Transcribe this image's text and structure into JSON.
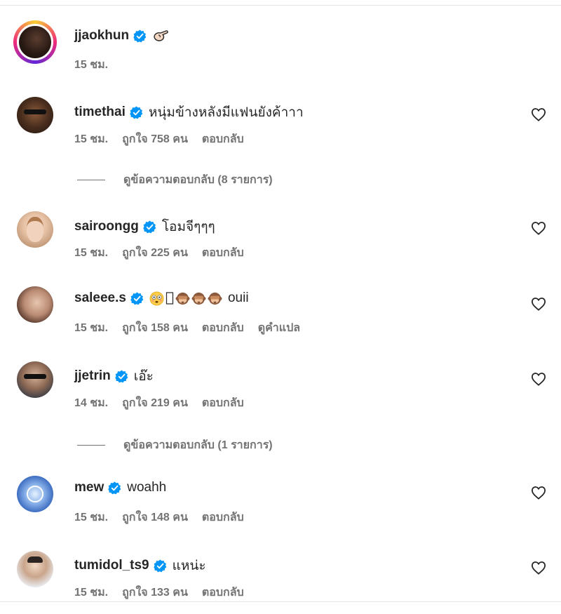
{
  "comments": [
    {
      "username": "jjaokhun",
      "text": "",
      "time": "15 ชม.",
      "likes": "",
      "reply": "",
      "translate": "",
      "has_heart": false,
      "emoji": "pinching-hand"
    },
    {
      "username": "timethai",
      "text": "หนุ่มข้างหลังมีแฟนยังค้าาา",
      "time": "15 ชม.",
      "likes": "ถูกใจ 758 คน",
      "reply": "ตอบกลับ",
      "translate": "",
      "has_heart": true
    },
    {
      "username": "sairoongg",
      "text": "โอมจีๆๆๆ",
      "time": "15 ชม.",
      "likes": "ถูกใจ 225 คน",
      "reply": "ตอบกลับ",
      "translate": "",
      "has_heart": true
    },
    {
      "username": "saleee.s",
      "text": "ouii",
      "time": "15 ชม.",
      "likes": "ถูกใจ 158 คน",
      "reply": "ตอบกลับ",
      "translate": "ดูคำแปล",
      "has_heart": true,
      "emoji": "flushed-face, box, see-no-evil-monkey x3"
    },
    {
      "username": "jjetrin",
      "text": "เอ๊ะ",
      "time": "14 ชม.",
      "likes": "ถูกใจ 219 คน",
      "reply": "ตอบกลับ",
      "translate": "",
      "has_heart": true
    },
    {
      "username": "mew",
      "text": "woahh",
      "time": "15 ชม.",
      "likes": "ถูกใจ 148 คน",
      "reply": "ตอบกลับ",
      "translate": "",
      "has_heart": true
    },
    {
      "username": "tumidol_ts9",
      "text": "แหน่ะ",
      "time": "15 ชม.",
      "likes": "ถูกใจ 133 คน",
      "reply": "ตอบกลับ",
      "translate": "",
      "has_heart": true
    }
  ],
  "view_replies": [
    {
      "label": "ดูข้อความตอบกลับ (8 รายการ)"
    },
    {
      "label": "ดูข้อความตอบกลับ (1 รายการ)"
    }
  ],
  "colors": {
    "verified": "#0095f6",
    "text": "#262626",
    "muted": "#737373"
  }
}
